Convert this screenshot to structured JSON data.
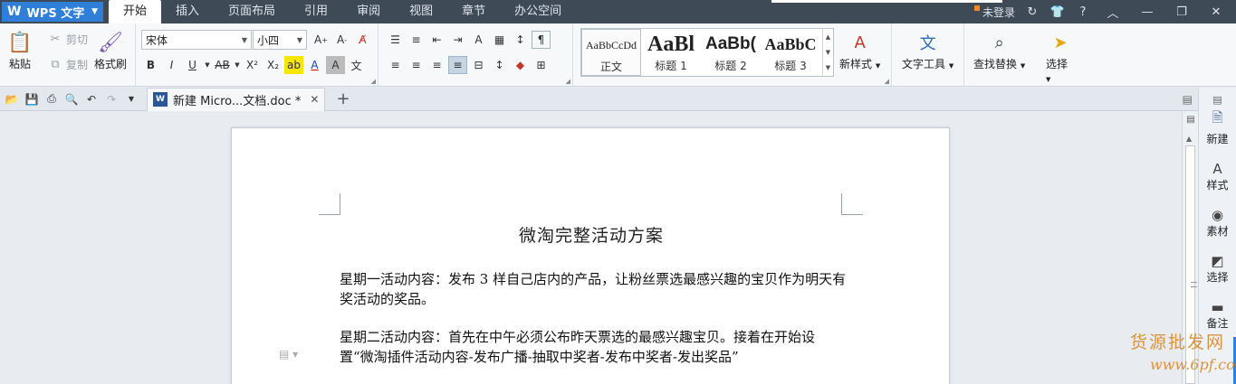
{
  "app": {
    "logo": "W",
    "name": "WPS 文字"
  },
  "menu": {
    "tabs": [
      "开始",
      "插入",
      "页面布局",
      "引用",
      "审阅",
      "视图",
      "章节",
      "办公空间"
    ],
    "login_label": "未登录"
  },
  "ribbon": {
    "clipboard": {
      "paste": "粘贴",
      "cut": "剪切",
      "copy": "复制",
      "format_painter": "格式刷"
    },
    "font": {
      "name": "宋体",
      "size": "小四"
    },
    "styles": [
      {
        "sample": "AaBbCcDd",
        "name": "正文"
      },
      {
        "sample": "AaBl",
        "name": "标题 1"
      },
      {
        "sample": "AaBb(",
        "name": "标题 2"
      },
      {
        "sample": "AaBbC",
        "name": "标题 3"
      }
    ],
    "new_style": "新样式",
    "text_tools": "文字工具",
    "find_replace": "查找替换",
    "select": "选择"
  },
  "doc_tab": {
    "title": "新建 Micro...文档.doc *"
  },
  "document": {
    "title": "微淘完整活动方案",
    "paragraphs": [
      "星期一活动内容：发布 3 样自己店内的产品，让粉丝票选最感兴趣的宝贝作为明天有奖活动的奖品。",
      "星期二活动内容：首先在中午必须公布昨天票选的最感兴趣宝贝。接着在开始设置“微淘插件活动内容-发布广播-抽取中奖者-发布中奖者-发出奖品”"
    ]
  },
  "task_pane": {
    "buttons": [
      {
        "label": "新建",
        "icon": "new-doc-icon"
      },
      {
        "label": "样式",
        "icon": "style-icon"
      },
      {
        "label": "素材",
        "icon": "material-icon"
      },
      {
        "label": "选择",
        "icon": "select-icon"
      },
      {
        "label": "备注",
        "icon": "note-icon"
      }
    ]
  },
  "watermark": {
    "text": "货源批发网",
    "url": "www.6pf.com"
  },
  "colors": {
    "menubar": "#3f4a57",
    "accent": "#2f7ed8",
    "watermark": "#d88a2a"
  }
}
